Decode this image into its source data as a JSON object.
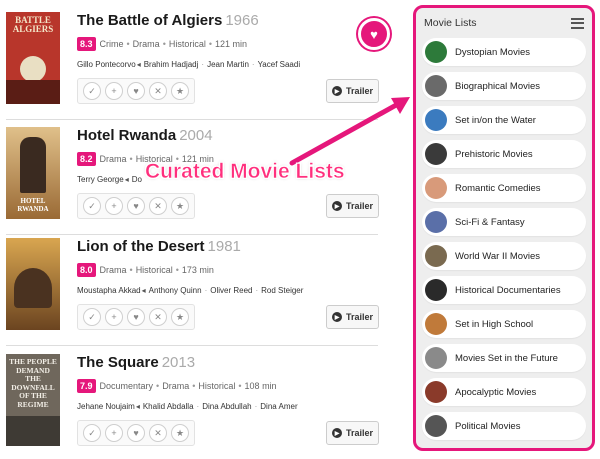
{
  "movies": [
    {
      "title": "The Battle of Algiers",
      "year": "1966",
      "rating": "8.3",
      "genres": [
        "Crime",
        "Drama",
        "Historical"
      ],
      "runtime": "121 min",
      "director": "Gillo Pontecorvo",
      "cast": [
        "Brahim Hadjadj",
        "Jean Martin",
        "Yacef Saadi"
      ],
      "poster_text": "BATTLE ALGIERS",
      "poster_bg": "#b8362b",
      "trailer_label": "Trailer"
    },
    {
      "title": "Hotel Rwanda",
      "year": "2004",
      "rating": "8.2",
      "genres": [
        "Drama",
        "Historical"
      ],
      "runtime": "121 min",
      "director": "Terry George",
      "cast": [
        "Do"
      ],
      "poster_text": "HOTEL RWANDA",
      "poster_bg": "#c8a067",
      "trailer_label": "Trailer"
    },
    {
      "title": "Lion of the Desert",
      "year": "1981",
      "rating": "8.0",
      "genres": [
        "Drama",
        "Historical"
      ],
      "runtime": "173 min",
      "director": "Moustapha Akkad",
      "cast": [
        "Anthony Quinn",
        "Oliver Reed",
        "Rod Steiger"
      ],
      "poster_text": "",
      "poster_bg": "#b58a3e",
      "trailer_label": "Trailer"
    },
    {
      "title": "The Square",
      "year": "2013",
      "rating": "7.9",
      "genres": [
        "Documentary",
        "Drama",
        "Historical"
      ],
      "runtime": "108 min",
      "director": "Jehane Noujaim",
      "cast": [
        "Khalid Abdalla",
        "Dina Abdullah",
        "Dina Amer"
      ],
      "poster_text": "THE PEOPLE DEMAND THE DOWNFALL OF THE REGIME",
      "poster_bg": "#6f675c",
      "trailer_label": "Trailer"
    }
  ],
  "callout": "Curated Movie Lists",
  "sidebar": {
    "title": "Movie Lists",
    "items": [
      {
        "label": "Dystopian Movies",
        "color": "#2d7a3a"
      },
      {
        "label": "Biographical Movies",
        "color": "#6a6a6a"
      },
      {
        "label": "Set in/on the Water",
        "color": "#3b7bbf"
      },
      {
        "label": "Prehistoric Movies",
        "color": "#3a3a3a"
      },
      {
        "label": "Romantic Comedies",
        "color": "#d89a7a"
      },
      {
        "label": "Sci-Fi & Fantasy",
        "color": "#5a6fa8"
      },
      {
        "label": "World War II Movies",
        "color": "#7a6a50"
      },
      {
        "label": "Historical Documentaries",
        "color": "#2a2a2a"
      },
      {
        "label": "Set in High School",
        "color": "#c07a3a"
      },
      {
        "label": "Movies Set in the Future",
        "color": "#8a8a8a"
      },
      {
        "label": "Apocalyptic Movies",
        "color": "#8a3a2a"
      },
      {
        "label": "Political Movies",
        "color": "#555555"
      }
    ]
  },
  "colors": {
    "accent": "#e5177b"
  }
}
